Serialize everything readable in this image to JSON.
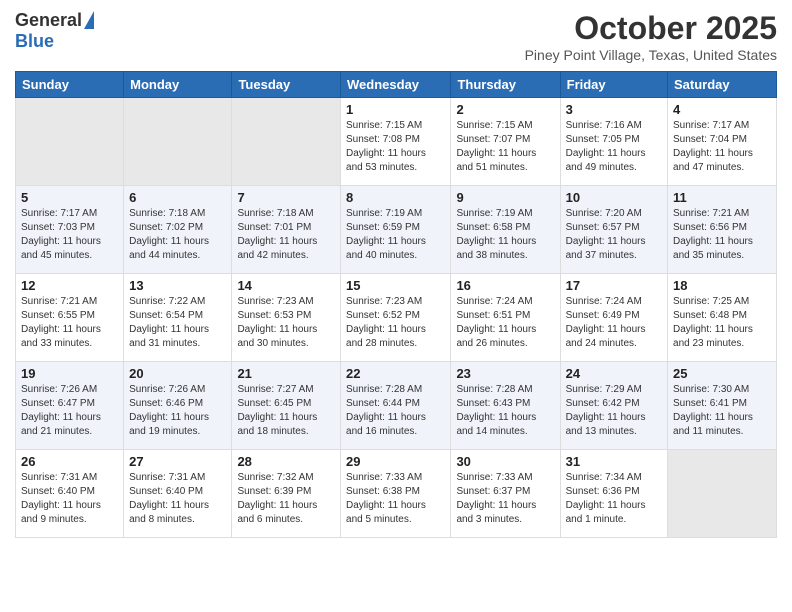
{
  "header": {
    "logo_general": "General",
    "logo_blue": "Blue",
    "month_title": "October 2025",
    "location": "Piney Point Village, Texas, United States"
  },
  "days_of_week": [
    "Sunday",
    "Monday",
    "Tuesday",
    "Wednesday",
    "Thursday",
    "Friday",
    "Saturday"
  ],
  "weeks": [
    [
      {
        "day": "",
        "info": ""
      },
      {
        "day": "",
        "info": ""
      },
      {
        "day": "",
        "info": ""
      },
      {
        "day": "1",
        "info": "Sunrise: 7:15 AM\nSunset: 7:08 PM\nDaylight: 11 hours\nand 53 minutes."
      },
      {
        "day": "2",
        "info": "Sunrise: 7:15 AM\nSunset: 7:07 PM\nDaylight: 11 hours\nand 51 minutes."
      },
      {
        "day": "3",
        "info": "Sunrise: 7:16 AM\nSunset: 7:05 PM\nDaylight: 11 hours\nand 49 minutes."
      },
      {
        "day": "4",
        "info": "Sunrise: 7:17 AM\nSunset: 7:04 PM\nDaylight: 11 hours\nand 47 minutes."
      }
    ],
    [
      {
        "day": "5",
        "info": "Sunrise: 7:17 AM\nSunset: 7:03 PM\nDaylight: 11 hours\nand 45 minutes."
      },
      {
        "day": "6",
        "info": "Sunrise: 7:18 AM\nSunset: 7:02 PM\nDaylight: 11 hours\nand 44 minutes."
      },
      {
        "day": "7",
        "info": "Sunrise: 7:18 AM\nSunset: 7:01 PM\nDaylight: 11 hours\nand 42 minutes."
      },
      {
        "day": "8",
        "info": "Sunrise: 7:19 AM\nSunset: 6:59 PM\nDaylight: 11 hours\nand 40 minutes."
      },
      {
        "day": "9",
        "info": "Sunrise: 7:19 AM\nSunset: 6:58 PM\nDaylight: 11 hours\nand 38 minutes."
      },
      {
        "day": "10",
        "info": "Sunrise: 7:20 AM\nSunset: 6:57 PM\nDaylight: 11 hours\nand 37 minutes."
      },
      {
        "day": "11",
        "info": "Sunrise: 7:21 AM\nSunset: 6:56 PM\nDaylight: 11 hours\nand 35 minutes."
      }
    ],
    [
      {
        "day": "12",
        "info": "Sunrise: 7:21 AM\nSunset: 6:55 PM\nDaylight: 11 hours\nand 33 minutes."
      },
      {
        "day": "13",
        "info": "Sunrise: 7:22 AM\nSunset: 6:54 PM\nDaylight: 11 hours\nand 31 minutes."
      },
      {
        "day": "14",
        "info": "Sunrise: 7:23 AM\nSunset: 6:53 PM\nDaylight: 11 hours\nand 30 minutes."
      },
      {
        "day": "15",
        "info": "Sunrise: 7:23 AM\nSunset: 6:52 PM\nDaylight: 11 hours\nand 28 minutes."
      },
      {
        "day": "16",
        "info": "Sunrise: 7:24 AM\nSunset: 6:51 PM\nDaylight: 11 hours\nand 26 minutes."
      },
      {
        "day": "17",
        "info": "Sunrise: 7:24 AM\nSunset: 6:49 PM\nDaylight: 11 hours\nand 24 minutes."
      },
      {
        "day": "18",
        "info": "Sunrise: 7:25 AM\nSunset: 6:48 PM\nDaylight: 11 hours\nand 23 minutes."
      }
    ],
    [
      {
        "day": "19",
        "info": "Sunrise: 7:26 AM\nSunset: 6:47 PM\nDaylight: 11 hours\nand 21 minutes."
      },
      {
        "day": "20",
        "info": "Sunrise: 7:26 AM\nSunset: 6:46 PM\nDaylight: 11 hours\nand 19 minutes."
      },
      {
        "day": "21",
        "info": "Sunrise: 7:27 AM\nSunset: 6:45 PM\nDaylight: 11 hours\nand 18 minutes."
      },
      {
        "day": "22",
        "info": "Sunrise: 7:28 AM\nSunset: 6:44 PM\nDaylight: 11 hours\nand 16 minutes."
      },
      {
        "day": "23",
        "info": "Sunrise: 7:28 AM\nSunset: 6:43 PM\nDaylight: 11 hours\nand 14 minutes."
      },
      {
        "day": "24",
        "info": "Sunrise: 7:29 AM\nSunset: 6:42 PM\nDaylight: 11 hours\nand 13 minutes."
      },
      {
        "day": "25",
        "info": "Sunrise: 7:30 AM\nSunset: 6:41 PM\nDaylight: 11 hours\nand 11 minutes."
      }
    ],
    [
      {
        "day": "26",
        "info": "Sunrise: 7:31 AM\nSunset: 6:40 PM\nDaylight: 11 hours\nand 9 minutes."
      },
      {
        "day": "27",
        "info": "Sunrise: 7:31 AM\nSunset: 6:40 PM\nDaylight: 11 hours\nand 8 minutes."
      },
      {
        "day": "28",
        "info": "Sunrise: 7:32 AM\nSunset: 6:39 PM\nDaylight: 11 hours\nand 6 minutes."
      },
      {
        "day": "29",
        "info": "Sunrise: 7:33 AM\nSunset: 6:38 PM\nDaylight: 11 hours\nand 5 minutes."
      },
      {
        "day": "30",
        "info": "Sunrise: 7:33 AM\nSunset: 6:37 PM\nDaylight: 11 hours\nand 3 minutes."
      },
      {
        "day": "31",
        "info": "Sunrise: 7:34 AM\nSunset: 6:36 PM\nDaylight: 11 hours\nand 1 minute."
      },
      {
        "day": "",
        "info": ""
      }
    ]
  ]
}
